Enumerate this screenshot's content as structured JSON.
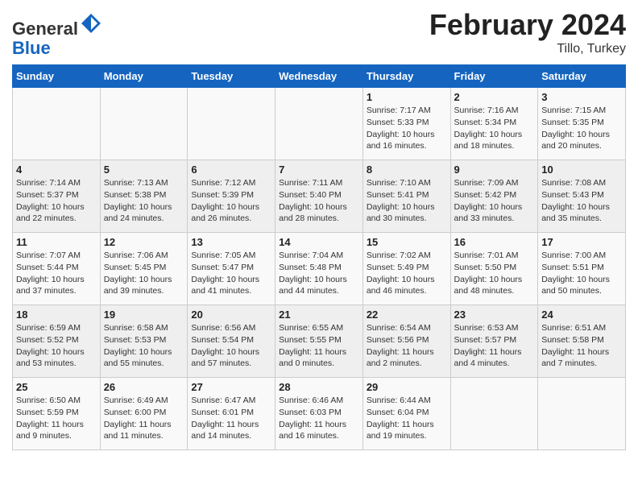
{
  "header": {
    "logo_general": "General",
    "logo_blue": "Blue",
    "month_title": "February 2024",
    "location": "Tillo, Turkey"
  },
  "days_of_week": [
    "Sunday",
    "Monday",
    "Tuesday",
    "Wednesday",
    "Thursday",
    "Friday",
    "Saturday"
  ],
  "weeks": [
    [
      {
        "day": "",
        "info": ""
      },
      {
        "day": "",
        "info": ""
      },
      {
        "day": "",
        "info": ""
      },
      {
        "day": "",
        "info": ""
      },
      {
        "day": "1",
        "info": "Sunrise: 7:17 AM\nSunset: 5:33 PM\nDaylight: 10 hours\nand 16 minutes."
      },
      {
        "day": "2",
        "info": "Sunrise: 7:16 AM\nSunset: 5:34 PM\nDaylight: 10 hours\nand 18 minutes."
      },
      {
        "day": "3",
        "info": "Sunrise: 7:15 AM\nSunset: 5:35 PM\nDaylight: 10 hours\nand 20 minutes."
      }
    ],
    [
      {
        "day": "4",
        "info": "Sunrise: 7:14 AM\nSunset: 5:37 PM\nDaylight: 10 hours\nand 22 minutes."
      },
      {
        "day": "5",
        "info": "Sunrise: 7:13 AM\nSunset: 5:38 PM\nDaylight: 10 hours\nand 24 minutes."
      },
      {
        "day": "6",
        "info": "Sunrise: 7:12 AM\nSunset: 5:39 PM\nDaylight: 10 hours\nand 26 minutes."
      },
      {
        "day": "7",
        "info": "Sunrise: 7:11 AM\nSunset: 5:40 PM\nDaylight: 10 hours\nand 28 minutes."
      },
      {
        "day": "8",
        "info": "Sunrise: 7:10 AM\nSunset: 5:41 PM\nDaylight: 10 hours\nand 30 minutes."
      },
      {
        "day": "9",
        "info": "Sunrise: 7:09 AM\nSunset: 5:42 PM\nDaylight: 10 hours\nand 33 minutes."
      },
      {
        "day": "10",
        "info": "Sunrise: 7:08 AM\nSunset: 5:43 PM\nDaylight: 10 hours\nand 35 minutes."
      }
    ],
    [
      {
        "day": "11",
        "info": "Sunrise: 7:07 AM\nSunset: 5:44 PM\nDaylight: 10 hours\nand 37 minutes."
      },
      {
        "day": "12",
        "info": "Sunrise: 7:06 AM\nSunset: 5:45 PM\nDaylight: 10 hours\nand 39 minutes."
      },
      {
        "day": "13",
        "info": "Sunrise: 7:05 AM\nSunset: 5:47 PM\nDaylight: 10 hours\nand 41 minutes."
      },
      {
        "day": "14",
        "info": "Sunrise: 7:04 AM\nSunset: 5:48 PM\nDaylight: 10 hours\nand 44 minutes."
      },
      {
        "day": "15",
        "info": "Sunrise: 7:02 AM\nSunset: 5:49 PM\nDaylight: 10 hours\nand 46 minutes."
      },
      {
        "day": "16",
        "info": "Sunrise: 7:01 AM\nSunset: 5:50 PM\nDaylight: 10 hours\nand 48 minutes."
      },
      {
        "day": "17",
        "info": "Sunrise: 7:00 AM\nSunset: 5:51 PM\nDaylight: 10 hours\nand 50 minutes."
      }
    ],
    [
      {
        "day": "18",
        "info": "Sunrise: 6:59 AM\nSunset: 5:52 PM\nDaylight: 10 hours\nand 53 minutes."
      },
      {
        "day": "19",
        "info": "Sunrise: 6:58 AM\nSunset: 5:53 PM\nDaylight: 10 hours\nand 55 minutes."
      },
      {
        "day": "20",
        "info": "Sunrise: 6:56 AM\nSunset: 5:54 PM\nDaylight: 10 hours\nand 57 minutes."
      },
      {
        "day": "21",
        "info": "Sunrise: 6:55 AM\nSunset: 5:55 PM\nDaylight: 11 hours\nand 0 minutes."
      },
      {
        "day": "22",
        "info": "Sunrise: 6:54 AM\nSunset: 5:56 PM\nDaylight: 11 hours\nand 2 minutes."
      },
      {
        "day": "23",
        "info": "Sunrise: 6:53 AM\nSunset: 5:57 PM\nDaylight: 11 hours\nand 4 minutes."
      },
      {
        "day": "24",
        "info": "Sunrise: 6:51 AM\nSunset: 5:58 PM\nDaylight: 11 hours\nand 7 minutes."
      }
    ],
    [
      {
        "day": "25",
        "info": "Sunrise: 6:50 AM\nSunset: 5:59 PM\nDaylight: 11 hours\nand 9 minutes."
      },
      {
        "day": "26",
        "info": "Sunrise: 6:49 AM\nSunset: 6:00 PM\nDaylight: 11 hours\nand 11 minutes."
      },
      {
        "day": "27",
        "info": "Sunrise: 6:47 AM\nSunset: 6:01 PM\nDaylight: 11 hours\nand 14 minutes."
      },
      {
        "day": "28",
        "info": "Sunrise: 6:46 AM\nSunset: 6:03 PM\nDaylight: 11 hours\nand 16 minutes."
      },
      {
        "day": "29",
        "info": "Sunrise: 6:44 AM\nSunset: 6:04 PM\nDaylight: 11 hours\nand 19 minutes."
      },
      {
        "day": "",
        "info": ""
      },
      {
        "day": "",
        "info": ""
      }
    ]
  ]
}
